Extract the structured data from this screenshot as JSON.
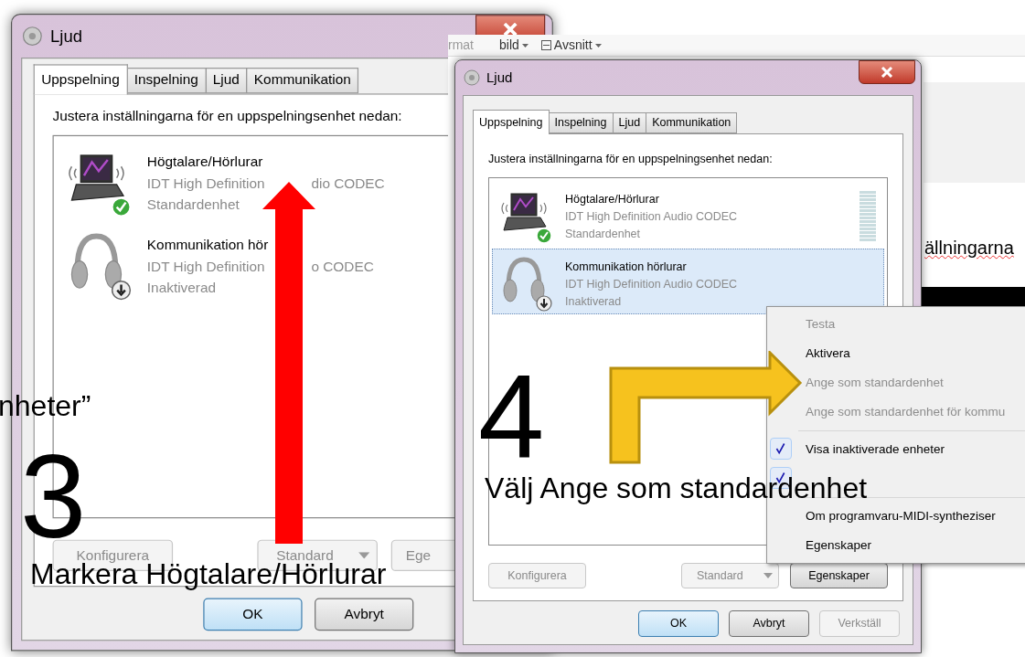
{
  "background_document": {
    "toolbar": [
      "rmat",
      "bild",
      "Avsnitt"
    ],
    "text": "ällningarna"
  },
  "dialogs": [
    {
      "title": "Ljud",
      "tabs": [
        {
          "label": "Uppspelning",
          "selected": true
        },
        {
          "label": "Inspelning",
          "selected": false
        },
        {
          "label": "Ljud",
          "selected": false
        },
        {
          "label": "Kommunikation",
          "selected": false
        }
      ],
      "instruction": "Justera inställningarna för en uppspelningsenhet nedan:",
      "devices": [
        {
          "kind": "laptop",
          "name": [
            "Högtalare/Hörlurar"
          ],
          "driver": [
            "IDT High Definition",
            "dio CODEC"
          ],
          "status": [
            "Standardenhet"
          ],
          "default": true,
          "selected": false
        },
        {
          "kind": "headphones",
          "name": [
            "Kommunikation hör"
          ],
          "driver": [
            "IDT High Definition",
            "o CODEC"
          ],
          "status": [
            "Inaktiverad"
          ],
          "default": false,
          "selected": false
        }
      ],
      "panel_buttons": [
        {
          "label": "Konfigurera",
          "kind": "plain",
          "disabled": true
        },
        {
          "label": "Standard",
          "kind": "split",
          "disabled": true
        },
        {
          "label": "Ege",
          "kind": "plain",
          "disabled": true
        }
      ],
      "buttons": [
        {
          "label": "OK",
          "default": true,
          "disabled": false
        },
        {
          "label": "Avbryt",
          "default": false,
          "disabled": false
        }
      ]
    },
    {
      "title": "Ljud",
      "tabs": [
        {
          "label": "Uppspelning",
          "selected": true
        },
        {
          "label": "Inspelning",
          "selected": false
        },
        {
          "label": "Ljud",
          "selected": false
        },
        {
          "label": "Kommunikation",
          "selected": false
        }
      ],
      "instruction": "Justera inställningarna för en uppspelningsenhet nedan:",
      "devices": [
        {
          "kind": "laptop",
          "name": [
            "Högtalare/Hörlurar"
          ],
          "driver": [
            "IDT High Definition Audio CODEC"
          ],
          "status": [
            "Standardenhet"
          ],
          "default": true,
          "selected": false
        },
        {
          "kind": "headphones",
          "name": [
            "Kommunikation hörlurar"
          ],
          "driver": [
            "IDT High Definition Audio CODEC"
          ],
          "status": [
            "Inaktiverad"
          ],
          "default": false,
          "selected": true
        }
      ],
      "panel_buttons": [
        {
          "label": "Konfigurera",
          "kind": "plain",
          "disabled": true
        },
        {
          "label": "Standard",
          "kind": "split",
          "disabled": true
        },
        {
          "label": "Egenskaper",
          "kind": "plain",
          "disabled": false
        }
      ],
      "buttons": [
        {
          "label": "OK",
          "default": true,
          "disabled": false
        },
        {
          "label": "Avbryt",
          "default": false,
          "disabled": false
        },
        {
          "label": "Verkställ",
          "default": false,
          "disabled": true
        }
      ]
    }
  ],
  "context_menu": {
    "groups": [
      [
        {
          "label": "Testa",
          "disabled": true,
          "checked": false
        },
        {
          "label": "Aktivera",
          "disabled": false,
          "checked": false
        },
        {
          "label": "Ange som standardenhet",
          "disabled": true,
          "checked": false
        },
        {
          "label": "Ange som standardenhet för kommu",
          "disabled": true,
          "checked": false
        }
      ],
      [
        {
          "label": "Visa inaktiverade enheter",
          "disabled": false,
          "checked": true
        },
        {
          "disabled": false,
          "checked": true
        }
      ],
      [
        {
          "label": "Om programvaru-MIDI-syntheziser",
          "disabled": false,
          "checked": false
        },
        {
          "label": "Egenskaper",
          "disabled": false,
          "checked": false
        }
      ]
    ]
  },
  "annotations": [
    {
      "kind": "caption",
      "text": "nheter”"
    },
    {
      "kind": "step",
      "text": "3"
    },
    {
      "kind": "caption",
      "text": "Markera Högtalare/Hörlurar"
    },
    {
      "kind": "step",
      "text": "4"
    },
    {
      "kind": "caption",
      "text": "Välj Ange som standardenhet"
    }
  ]
}
